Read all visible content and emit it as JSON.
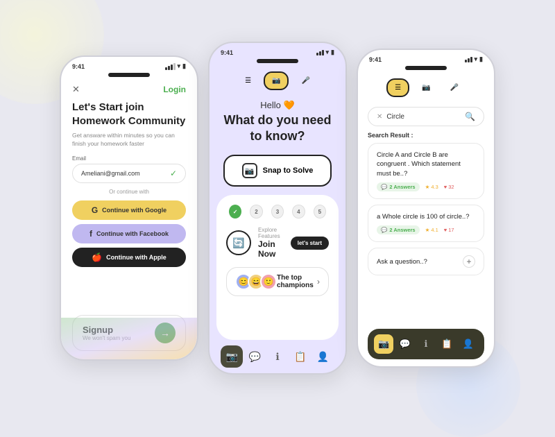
{
  "bg": "#e8e8f0",
  "phone1": {
    "status_time": "9:41",
    "close_label": "✕",
    "login_label": "Login",
    "title_part1": "Let's Start join",
    "title_part2": "Homework ",
    "title_bold": "Community",
    "subtitle": "Get answare within minutes so you can finish your homework faster",
    "email_label": "Email",
    "email_value": "Ameliani@gmail.com",
    "divider_text": "Or continue with",
    "google_btn": "Continue with Google",
    "facebook_btn": "Continue with Facebook",
    "apple_btn": "Continue with Apple",
    "signup_title": "Signup",
    "signup_sub": "We won't spam you"
  },
  "phone2": {
    "status_time": "9:41",
    "hello_text": "Hello 🧡",
    "question": "What do you need to know?",
    "snap_label": "Snap to Solve",
    "steps": [
      "✓",
      "2",
      "3",
      "4",
      "5"
    ],
    "feature_label": "Explore Features",
    "feature_title": "Join Now",
    "lets_start": "let's start",
    "champions_label": "The top champions",
    "nav_icons": [
      "📷",
      "💬",
      "ℹ",
      "📋",
      "👤"
    ]
  },
  "phone3": {
    "status_time": "9:41",
    "search_value": "Circle",
    "result_label": "Search Result :",
    "q1": "Circle A and Circle B are congruent . Which statement must be..?",
    "q1_answers": "2 Answers",
    "q1_rating": "4.3",
    "q1_likes": "32",
    "q2": "a Whole circle is 100 of circle..?",
    "q2_answers": "2 Answers",
    "q2_rating": "4.1",
    "q2_likes": "17",
    "q3": "Ask a question..?",
    "nav_icons": [
      "📷",
      "💬",
      "ℹ",
      "📋",
      "👤"
    ]
  },
  "colors": {
    "green": "#4CAF50",
    "yellow": "#f0d060",
    "purple_light": "#e8e4ff",
    "dark": "#222222",
    "google_bg": "#f0d060",
    "facebook_bg": "#c0b8f0"
  }
}
